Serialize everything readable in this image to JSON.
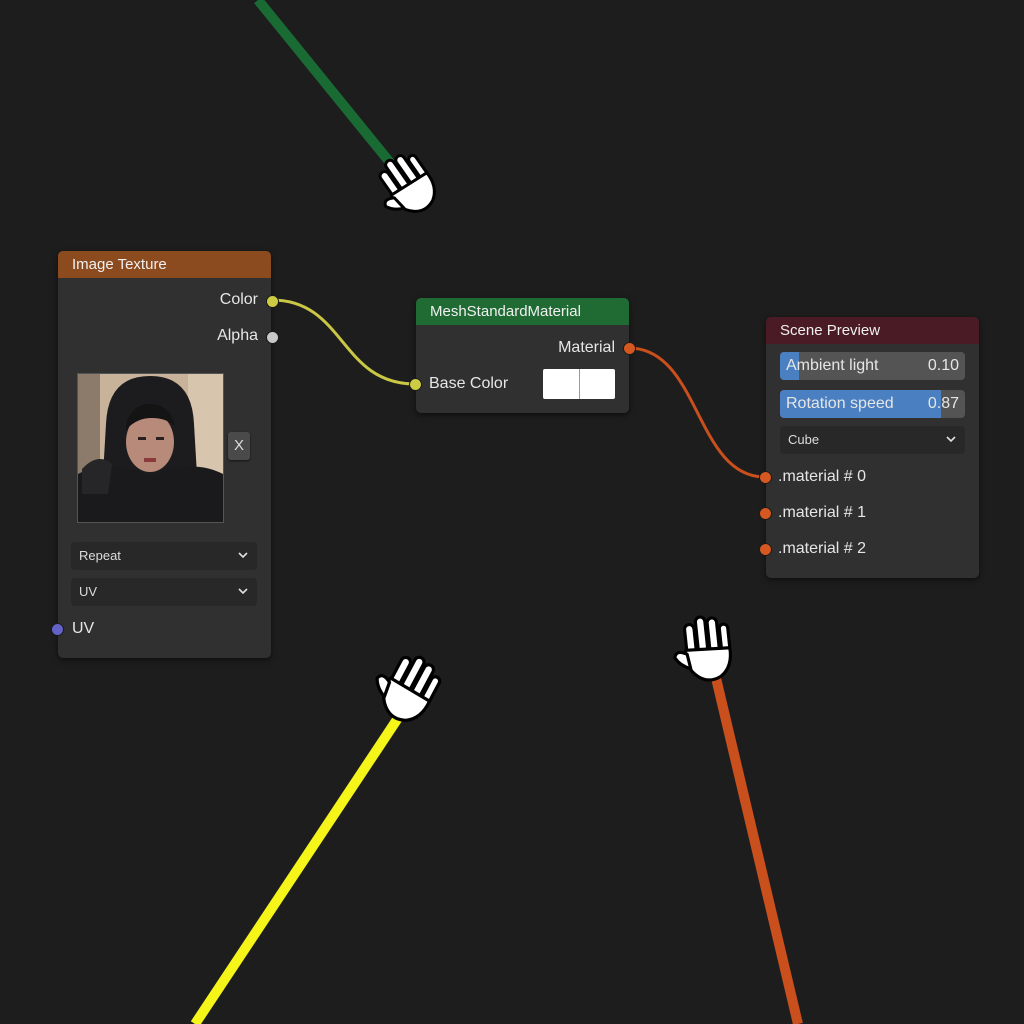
{
  "image_texture": {
    "title": "Image Texture",
    "outputs": [
      "Color",
      "Alpha"
    ],
    "clear_label": "X",
    "wrap_mode": "Repeat",
    "mapping": "UV",
    "input": "UV"
  },
  "mesh_material": {
    "title": "MeshStandardMaterial",
    "output": "Material",
    "input": "Base Color",
    "base_color": "#ffffff"
  },
  "scene_preview": {
    "title": "Scene Preview",
    "sliders": [
      {
        "label": "Ambient light",
        "value": "0.10",
        "fraction": 0.1
      },
      {
        "label": "Rotation speed",
        "value": "0.87",
        "fraction": 0.87
      }
    ],
    "geometry": "Cube",
    "inputs": [
      ".material # 0",
      ".material # 1",
      ".material # 2"
    ]
  },
  "colors": {
    "background": "#1d1d1d",
    "image_texture_header": "#8c4a1f",
    "mesh_material_header": "#1f6b33",
    "scene_preview_header": "#4a1b24",
    "color_socket": "#cccc44",
    "alpha_socket": "#c8c8c8",
    "uv_socket": "#6363c7",
    "material_socket": "#d4581f",
    "wire_color": "#c9c744",
    "wire_material": "#c94f1c",
    "pointer_wire_green": "#1a6b33",
    "pointer_wire_yellow": "#f5f51a",
    "pointer_wire_orange": "#c94f1c"
  },
  "icons": [
    "hand-cursor-icon",
    "chevron-down-icon"
  ]
}
